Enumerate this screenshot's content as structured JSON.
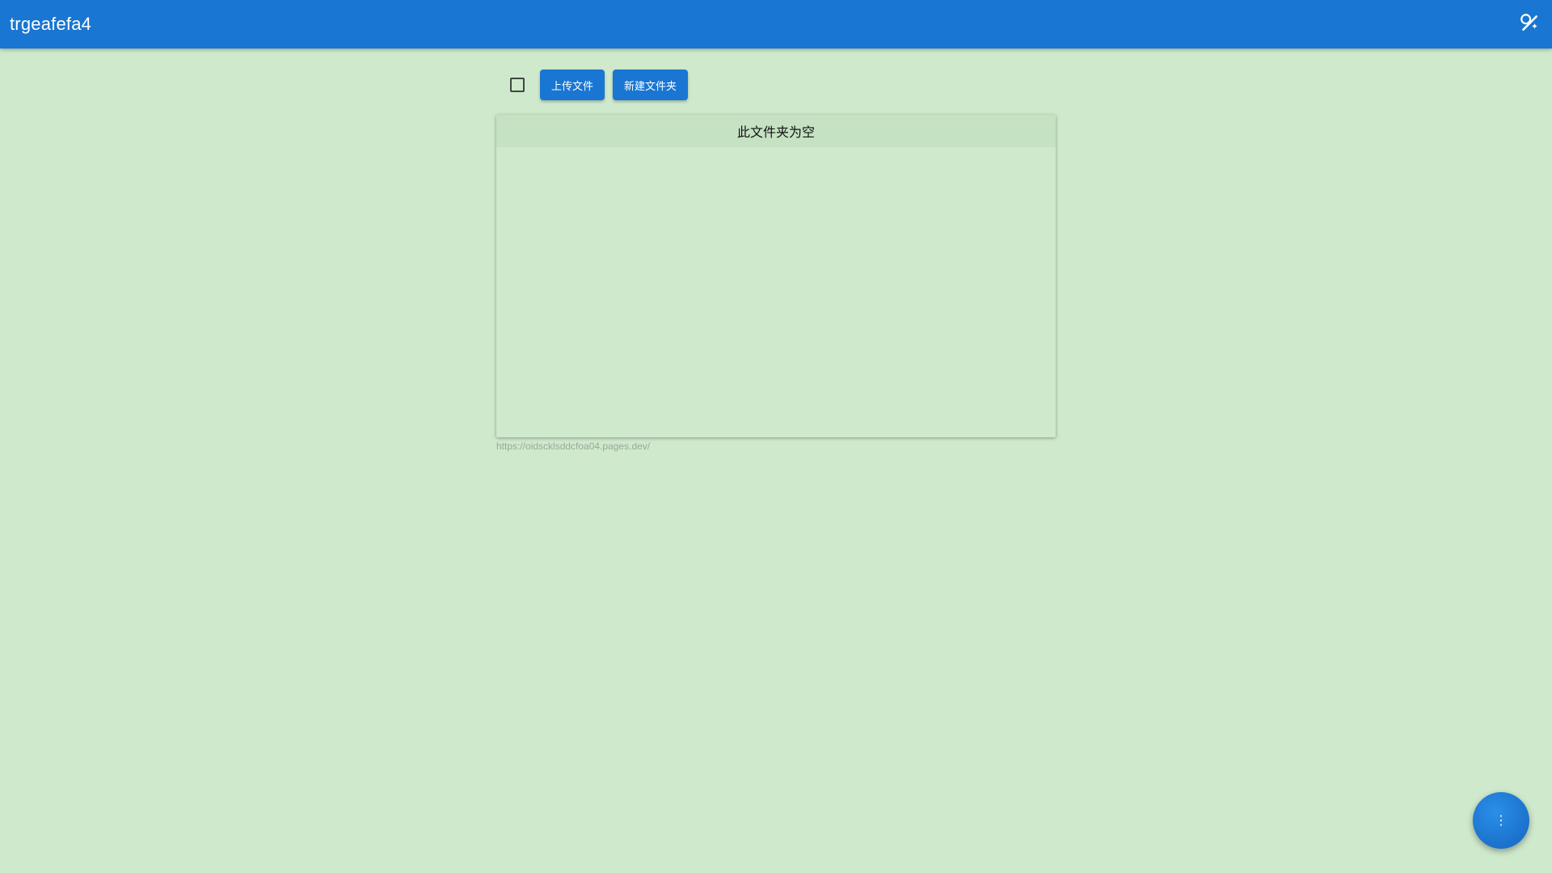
{
  "appbar": {
    "title": "trgeafefa4",
    "theme_icon": "theme-toggle-icon"
  },
  "toolbar": {
    "upload_label": "上传文件",
    "new_folder_label": "新建文件夹"
  },
  "panel": {
    "empty_message": "此文件夹为空"
  },
  "footer": {
    "url": "https://oidscklsddcfoa04.pages.dev/"
  },
  "fab": {
    "label": "⋮",
    "icon": "more-vert-icon"
  },
  "colors": {
    "primary": "#1976d2",
    "background": "#cfe9cc",
    "panel_header": "#c5e2c2"
  }
}
